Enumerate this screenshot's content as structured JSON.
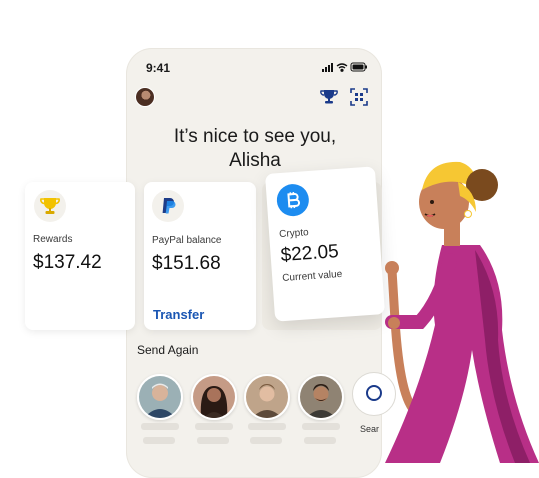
{
  "status_bar": {
    "time": "9:41"
  },
  "greeting": {
    "line1": "It’s nice to see you,",
    "line2": "Alisha"
  },
  "cards": {
    "rewards": {
      "label": "Rewards",
      "amount": "$137.42",
      "icon": "trophy-icon"
    },
    "paypal": {
      "label": "PayPal balance",
      "amount": "$151.68",
      "action": "Transfer",
      "icon": "paypal-logo-icon"
    },
    "crypto": {
      "label": "Crypto",
      "amount": "$22.05",
      "sublabel": "Current value",
      "icon": "bitcoin-icon"
    }
  },
  "send_again": {
    "title": "Send Again",
    "search_label": "Sear",
    "contacts": [
      "contact-1",
      "contact-2",
      "contact-3",
      "contact-4"
    ]
  },
  "colors": {
    "paypal_blue": "#1a56b3",
    "crypto_blue": "#1d8cf0",
    "trophy_gold": "#f2c200",
    "illustration_magenta": "#b82f87",
    "illustration_hair": "#f6c733"
  }
}
